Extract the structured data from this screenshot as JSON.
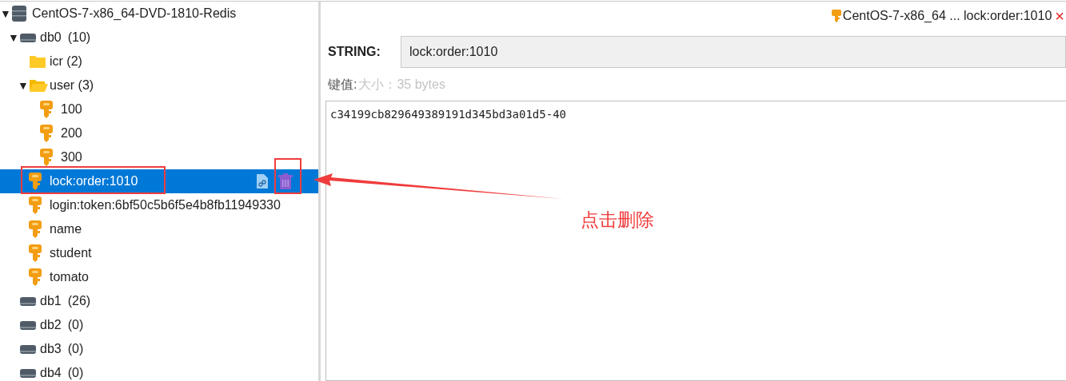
{
  "tree": {
    "label": "CentOS-7-x86_64-DVD-1810-Redis",
    "kind": "server",
    "expanded": true,
    "toggle": "▼",
    "selected": false,
    "children": [
      {
        "label": "db0",
        "count": "(10)",
        "kind": "db",
        "expanded": true,
        "toggle": "▼",
        "selected": false,
        "children": [
          {
            "label": "icr (2)",
            "kind": "folder",
            "selected": false
          },
          {
            "label": "user (3)",
            "kind": "folder",
            "expanded": true,
            "toggle": "▼",
            "selected": false,
            "children": [
              {
                "label": "100",
                "kind": "key",
                "selected": false
              },
              {
                "label": "200",
                "kind": "key",
                "selected": false
              },
              {
                "label": "300",
                "kind": "key",
                "selected": false
              }
            ]
          },
          {
            "label": "lock:order:1010",
            "kind": "key",
            "selected": true
          },
          {
            "label": "login:token:6bf50c5b6f5e4b8fb11949330",
            "kind": "key",
            "selected": false
          },
          {
            "label": "name",
            "kind": "key",
            "selected": false
          },
          {
            "label": "student",
            "kind": "key",
            "selected": false
          },
          {
            "label": "tomato",
            "kind": "key",
            "selected": false
          }
        ]
      },
      {
        "label": "db1",
        "count": "(26)",
        "kind": "db",
        "selected": false
      },
      {
        "label": "db2",
        "count": "(0)",
        "kind": "db",
        "selected": false
      },
      {
        "label": "db3",
        "count": "(0)",
        "kind": "db",
        "selected": false
      },
      {
        "label": "db4",
        "count": "(0)",
        "kind": "db",
        "selected": false
      }
    ]
  },
  "tab": {
    "title": "CentOS-7-x86_64 ... lock:order:1010",
    "close": "×"
  },
  "editor": {
    "type_label": "STRING:",
    "key_name": "lock:order:1010",
    "value_label": "键值:",
    "size": "大小：35 bytes",
    "value": "c34199cb829649389191d345bd3a01d5-40"
  },
  "annotation": {
    "text": "点击删除"
  }
}
